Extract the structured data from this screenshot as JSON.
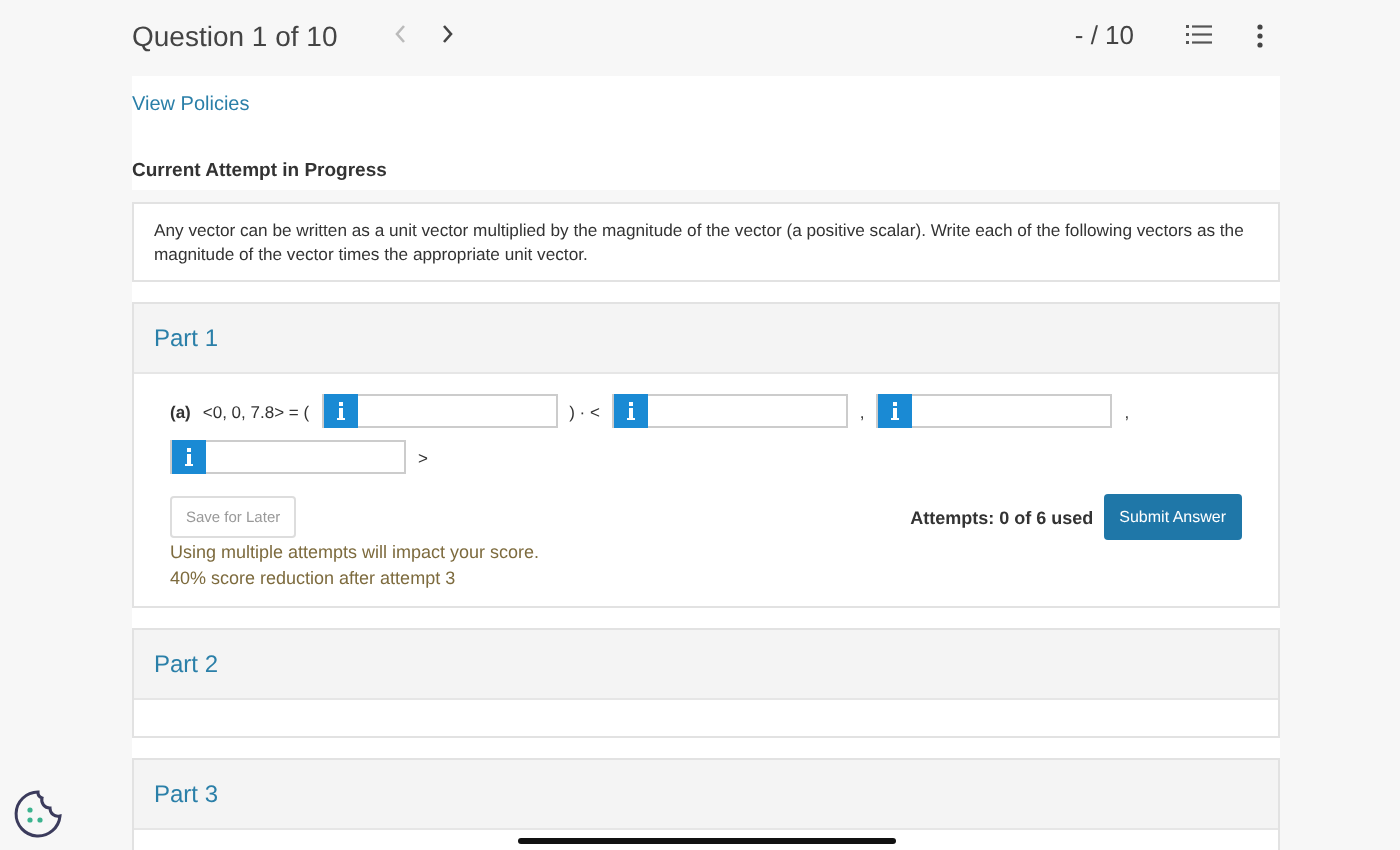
{
  "header": {
    "question_label": "Question 1 of 10",
    "prev": {
      "disabled": true
    },
    "next": {
      "disabled": false
    },
    "score": "- / 10"
  },
  "policies_link": "View Policies",
  "attempt_status": "Current Attempt in Progress",
  "instructions": "Any vector can be written as a unit vector multiplied by the magnitude of the vector (a positive scalar). Write each of the following vectors as the magnitude of the vector times the appropriate unit vector.",
  "parts": [
    {
      "title": "Part 1",
      "lines": [
        [
          {
            "kind": "text",
            "text": "(a)",
            "bold": true
          },
          {
            "kind": "text",
            "text": "<0, 0, 7.8> = (",
            "bold": false
          },
          {
            "kind": "field"
          },
          {
            "kind": "text",
            "text": ") · <",
            "bold": false
          },
          {
            "kind": "field"
          },
          {
            "kind": "text",
            "text": ",",
            "bold": false
          },
          {
            "kind": "field"
          },
          {
            "kind": "text",
            "text": ",",
            "bold": false
          }
        ],
        [
          {
            "kind": "field"
          },
          {
            "kind": "text",
            "text": ">",
            "bold": false
          }
        ]
      ],
      "save_button": {
        "label": "Save for Later",
        "disabled": true
      },
      "attempts": "Attempts: 0 of 6 used",
      "submit_button": {
        "label": "Submit Answer"
      },
      "notes": [
        "Using multiple attempts will impact your score.",
        "40% score reduction after attempt 3"
      ]
    },
    {
      "title": "Part 2"
    },
    {
      "title": "Part 3"
    }
  ]
}
